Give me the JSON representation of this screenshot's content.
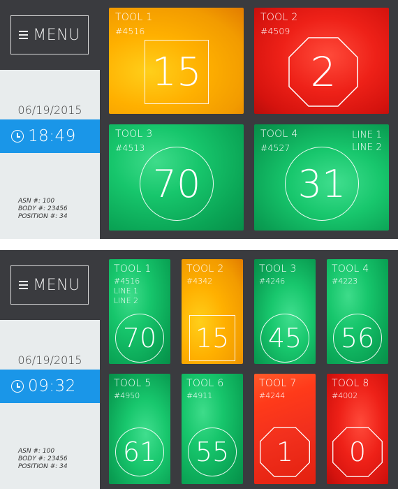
{
  "screens": [
    {
      "menu_label": "MENU",
      "date": "06/19/2015",
      "time": "18:49",
      "info": [
        "ASN #: 100",
        "BODY #: 23456",
        "POSITION #: 34"
      ],
      "tiles": [
        {
          "name": "TOOL 1",
          "num": "#4516",
          "value": "15",
          "color": "yellow",
          "shape": "square",
          "lines": []
        },
        {
          "name": "TOOL 2",
          "num": "#4509",
          "value": "2",
          "color": "red",
          "shape": "octagon",
          "lines": []
        },
        {
          "name": "TOOL 3",
          "num": "#4513",
          "value": "70",
          "color": "green",
          "shape": "circle",
          "lines": []
        },
        {
          "name": "TOOL 4",
          "num": "#4527",
          "value": "31",
          "color": "green",
          "shape": "circle",
          "lines": [
            "LINE 1",
            "LINE 2"
          ]
        }
      ]
    },
    {
      "menu_label": "MENU",
      "date": "06/19/2015",
      "time": "09:32",
      "info": [
        "ASN #: 100",
        "BODY #: 23456",
        "POSITION #: 34"
      ],
      "tiles": [
        {
          "name": "TOOL 1",
          "num": "#4516",
          "value": "70",
          "color": "green",
          "shape": "circle",
          "lines": [
            "LINE 1",
            "LINE 2"
          ]
        },
        {
          "name": "TOOL 2",
          "num": "#4342",
          "value": "15",
          "color": "yellow",
          "shape": "square",
          "lines": []
        },
        {
          "name": "TOOL 3",
          "num": "#4246",
          "value": "45",
          "color": "green",
          "shape": "circle",
          "lines": []
        },
        {
          "name": "TOOL 4",
          "num": "#4223",
          "value": "56",
          "color": "green",
          "shape": "circle",
          "lines": []
        },
        {
          "name": "TOOL 5",
          "num": "#4950",
          "value": "61",
          "color": "green",
          "shape": "circle",
          "lines": []
        },
        {
          "name": "TOOL 6",
          "num": "#4911",
          "value": "55",
          "color": "green",
          "shape": "circle",
          "lines": []
        },
        {
          "name": "TOOL 7",
          "num": "#4244",
          "value": "1",
          "color": "red",
          "shape": "octagon",
          "lines": []
        },
        {
          "name": "TOOL 8",
          "num": "#4002",
          "value": "0",
          "color": "red",
          "shape": "octagon",
          "lines": []
        }
      ]
    }
  ],
  "colors": {
    "panel_bg": "#3a3b3f",
    "sidebar_light": "#e8eced",
    "time_accent": "#1a96e8",
    "status_green": "#17c66c",
    "status_yellow": "#ffb000",
    "status_red": "#ee2118"
  },
  "icons": [
    "hamburger-icon",
    "clock-icon"
  ]
}
